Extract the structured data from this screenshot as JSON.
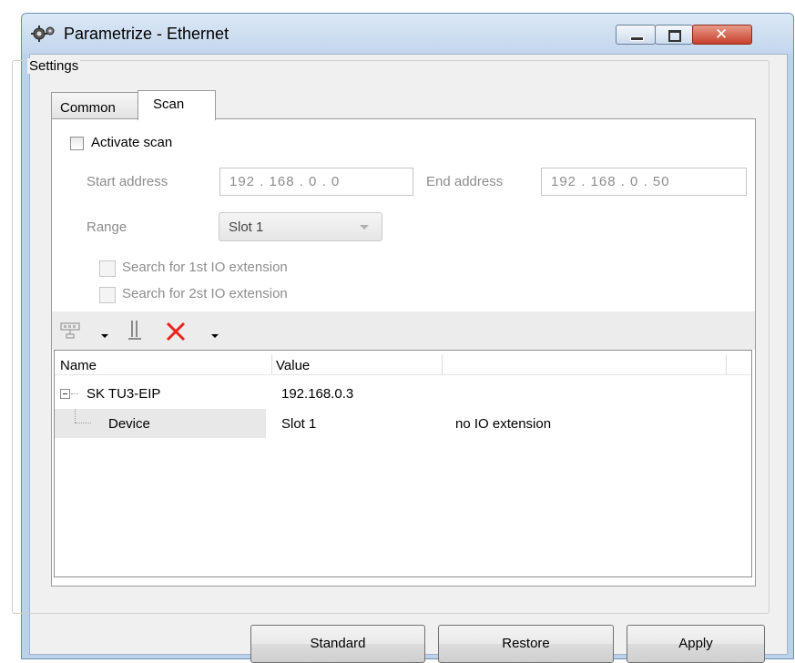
{
  "window": {
    "title": "Parametrize - Ethernet",
    "title_icon": "gear-icon",
    "controls": [
      "minimize-icon",
      "maximize-icon",
      "close-icon"
    ]
  },
  "settings": {
    "group_label": "Settings",
    "tabs": [
      {
        "label": "Common",
        "selected": false
      },
      {
        "label": "Scan",
        "selected": true
      }
    ]
  },
  "scan": {
    "activate_label": "Activate scan",
    "activate_checked": false,
    "start_label": "Start address",
    "start_value": "192 . 168 .  0  .  0",
    "end_label": "End address",
    "end_value": "192 . 168 .  0  .  50",
    "range_label": "Range",
    "range_value": "Slot 1",
    "search1_label": "Search for 1st IO extension",
    "search2_label": "Search for 2st IO extension"
  },
  "toolbar": {
    "icons": [
      "network-scan-icon",
      "dropdown-arrow-icon",
      "device-icon",
      "delete-icon",
      "dropdown-arrow-icon"
    ]
  },
  "grid": {
    "headers": [
      "Name",
      "Value",
      ""
    ],
    "rows": [
      {
        "name": "SK TU3-EIP",
        "value": "192.168.0.3",
        "extra": "",
        "level": 0
      },
      {
        "name": "Device",
        "value": "Slot 1",
        "extra": "no IO extension",
        "level": 1
      }
    ]
  },
  "buttons": {
    "standard": "Standard",
    "restore": "Restore",
    "apply": "Apply"
  },
  "colors": {
    "delete_icon": "#e8231b",
    "title_bar": "#c3d6ec",
    "close_button": "#c7402c"
  }
}
